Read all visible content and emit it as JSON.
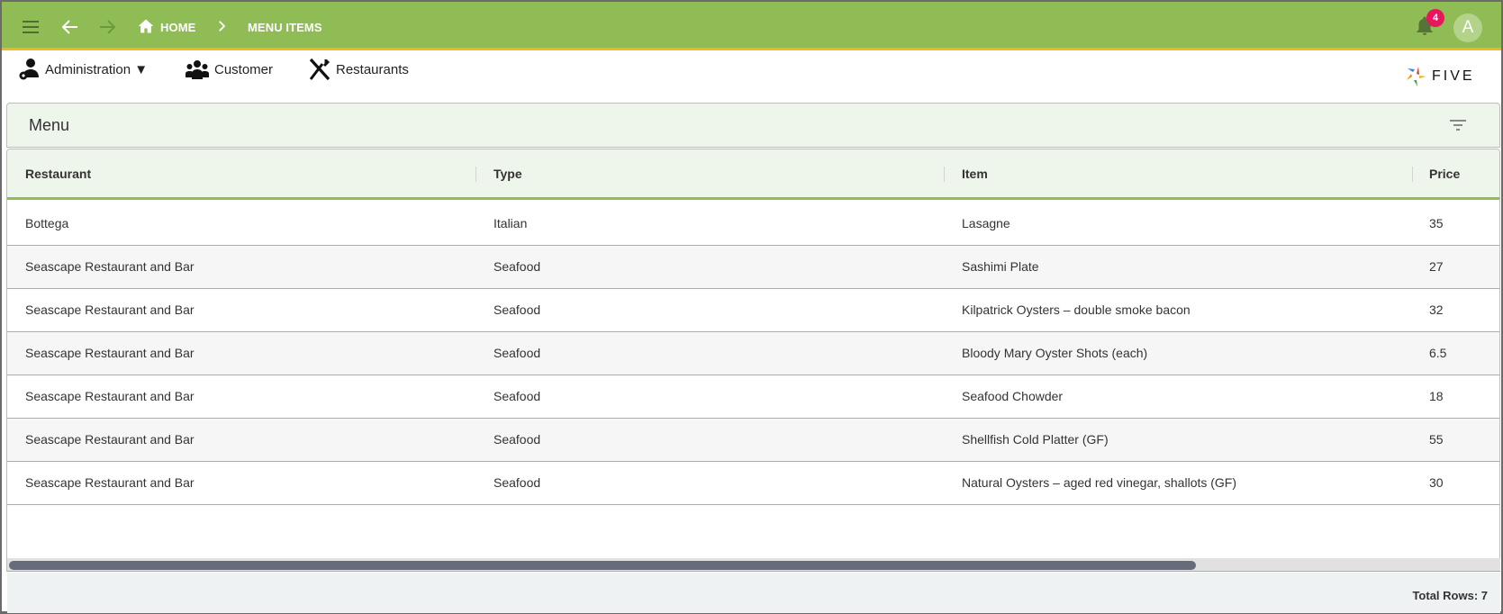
{
  "topbar": {
    "breadcrumb": [
      {
        "label": "HOME",
        "icon": "home-icon"
      },
      {
        "label": "MENU ITEMS"
      }
    ],
    "notification_count": "4",
    "avatar_initial": "A",
    "colors": {
      "bar": "#8fbc54",
      "accent_line": "#f3b51f",
      "badge": "#e8175d"
    }
  },
  "nav": {
    "items": [
      {
        "label": "Administration ▼",
        "icon": "admin-gear-icon"
      },
      {
        "label": "Customer",
        "icon": "group-icon"
      },
      {
        "label": "Restaurants",
        "icon": "cutlery-icon"
      }
    ],
    "logo_text": "FIVE"
  },
  "panel": {
    "title": "Menu"
  },
  "table": {
    "columns": [
      "Restaurant",
      "Type",
      "Item",
      "Price"
    ],
    "rows": [
      [
        "Bottega",
        "Italian",
        "Lasagne",
        "35"
      ],
      [
        "Seascape Restaurant and Bar",
        "Seafood",
        "Sashimi Plate",
        "27"
      ],
      [
        "Seascape Restaurant and Bar",
        "Seafood",
        "Kilpatrick Oysters – double smoke bacon",
        "32"
      ],
      [
        "Seascape Restaurant and Bar",
        "Seafood",
        "Bloody Mary Oyster Shots (each)",
        "6.5"
      ],
      [
        "Seascape Restaurant and Bar",
        "Seafood",
        "Seafood Chowder",
        "18"
      ],
      [
        "Seascape Restaurant and Bar",
        "Seafood",
        "Shellfish Cold Platter (GF)",
        "55"
      ],
      [
        "Seascape Restaurant and Bar",
        "Seafood",
        "Natural Oysters – aged red vinegar, shallots (GF)",
        "30"
      ]
    ]
  },
  "footer": {
    "total_rows": "Total Rows: 7"
  }
}
